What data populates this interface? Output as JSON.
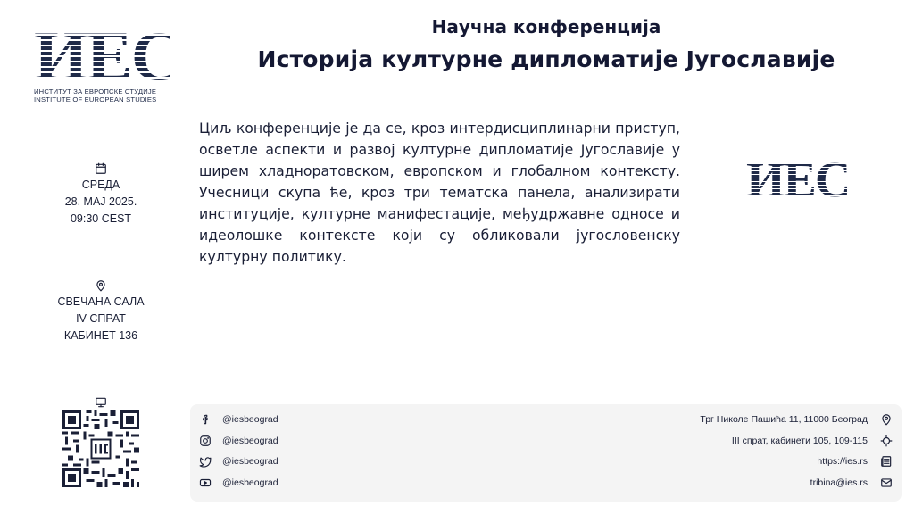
{
  "logo": {
    "mark": "ИЕС",
    "line1": "ИНСТИТУТ ЗА ЕВРОПСКЕ СТУДИЈЕ",
    "line2": "INSTITUTE OF EUROPEAN STUDIES"
  },
  "header": {
    "kicker": "Научна конференција",
    "title": "Историја културне дипломатије Југославије"
  },
  "description": "Циљ конференције је да се, кроз интердисциплинарни приступ, осветле аспекти и развој културне дипломатије Југославије у ширем хладноратовском, европском и глобалном контексту. Учесници скупа ће, кроз три тематска панела, анализирати институције, културне манифестације, међудржавне односе и идеолошке контексте који су обликовали југословенску културну политику.",
  "side_logo": "ИЕС",
  "event_date": {
    "icon": "calendar-icon",
    "weekday": "СРЕДА",
    "date": "28. MAJ 2025.",
    "time": "09:30 CEST"
  },
  "event_place": {
    "icon": "location-pin-icon",
    "line1": "СВЕЧАНА САЛА",
    "line2": "IV СПРАТ",
    "line3": "КАБИНЕТ 136"
  },
  "footer": {
    "social": [
      {
        "icon": "facebook-icon",
        "handle": "@iesbeograd"
      },
      {
        "icon": "instagram-icon",
        "handle": "@iesbeograd"
      },
      {
        "icon": "twitter-icon",
        "handle": "@iesbeograd"
      },
      {
        "icon": "youtube-icon",
        "handle": "@iesbeograd"
      }
    ],
    "contact": [
      {
        "icon": "location-pin-icon",
        "text": "Трг Николе Пашића 11, 11000 Београд"
      },
      {
        "icon": "crosshair-icon",
        "text": "III спрат, кабинети 105, 109-115"
      },
      {
        "icon": "newspaper-icon",
        "text": "https://ies.rs"
      },
      {
        "icon": "mail-icon",
        "text": "tribina@ies.rs"
      }
    ]
  },
  "colors": {
    "text": "#1a1f36",
    "logo": "#1f2a48",
    "footer_bg": "#f4f4f4"
  }
}
